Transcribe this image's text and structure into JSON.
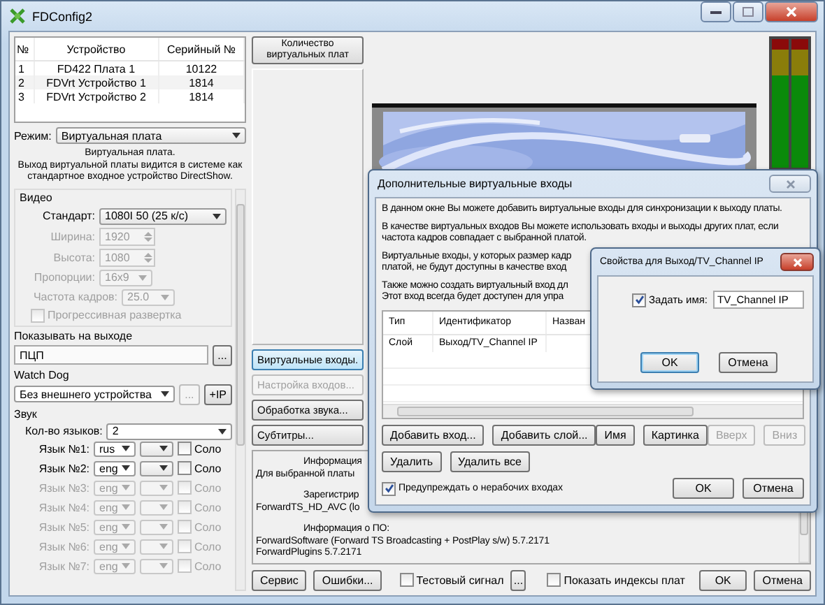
{
  "window": {
    "title": "FDConfig2"
  },
  "boards": {
    "columns": [
      "№",
      "Устройство",
      "Серийный №"
    ],
    "rows": [
      [
        "1",
        "FD422 Плата 1",
        "10122"
      ],
      [
        "2",
        "FDVrt Устройство 1",
        "1814"
      ],
      [
        "3",
        "FDVrt Устройство 2",
        "1814"
      ]
    ]
  },
  "mode": {
    "label": "Режим:",
    "value": "Виртуальная плата"
  },
  "mode_description": "Виртуальная плата.\nВыход виртуальной платы видится в системе как\nстандартное входное устройство DirectShow.",
  "video": {
    "title": "Видео",
    "fields": [
      {
        "kind": "select",
        "label": "Стандарт:",
        "value": "1080I 50 (25 к/с)",
        "disabled": false
      },
      {
        "kind": "spin",
        "label": "Ширина:",
        "value": "1920",
        "disabled": true
      },
      {
        "kind": "spin",
        "label": "Высота:",
        "value": "1080",
        "disabled": true
      },
      {
        "kind": "select",
        "label": "Пропорции:",
        "value": "16x9",
        "disabled": true
      },
      {
        "kind": "select",
        "label": "Частота кадров:",
        "value": "25.0",
        "disabled": true
      }
    ],
    "progressive": {
      "label": "Прогрессивная развертка",
      "checked": false,
      "disabled": true
    }
  },
  "output": {
    "title": "Показывать на выходе",
    "value": "ПЦП",
    "button": "..."
  },
  "watchdog": {
    "title": "Watch Dog",
    "value": "Без внешнего устройства",
    "buttons": [
      {
        "label": "...",
        "disabled": true
      },
      {
        "label": "+IP",
        "disabled": false
      }
    ]
  },
  "sound": {
    "title": "Звук",
    "count_label": "Кол-во языков:",
    "count": "2",
    "languages": [
      {
        "label": "Язык №1:",
        "lang": "rus",
        "solo_label": "Соло",
        "solo": false,
        "disabled": false
      },
      {
        "label": "Язык №2:",
        "lang": "eng",
        "solo_label": "Соло",
        "solo": false,
        "disabled": false
      },
      {
        "label": "Язык №3:",
        "lang": "eng",
        "solo_label": "Соло",
        "solo": false,
        "disabled": true
      },
      {
        "label": "Язык №4:",
        "lang": "eng",
        "solo_label": "Соло",
        "solo": false,
        "disabled": true
      },
      {
        "label": "Язык №5:",
        "lang": "eng",
        "solo_label": "Соло",
        "solo": false,
        "disabled": true
      },
      {
        "label": "Язык №6:",
        "lang": "eng",
        "solo_label": "Соло",
        "solo": false,
        "disabled": true
      },
      {
        "label": "Язык №7:",
        "lang": "eng",
        "solo_label": "Соло",
        "solo": false,
        "disabled": true
      }
    ]
  },
  "boards_count_button": "Количество\nвиртуальных плат",
  "side_buttons": [
    {
      "label": "Виртуальные входы.",
      "selected": true,
      "disabled": false
    },
    {
      "label": "Настройка входов...",
      "selected": false,
      "disabled": true
    },
    {
      "label": "Обработка звука...",
      "selected": false,
      "disabled": false
    },
    {
      "label": "Субтитры...",
      "selected": false,
      "disabled": false
    }
  ],
  "meters": [
    {
      "level": 1
    },
    {
      "level": 1
    }
  ],
  "info": [
    {
      "heading": "Информация",
      "lines": [
        "Для выбранной платы"
      ]
    },
    {
      "heading": "Зарегистрир",
      "lines": [
        "ForwardTS_HD_AVC (lo"
      ]
    },
    {
      "heading": "Информация о ПО:",
      "lines": [
        "ForwardSoftware (Forward TS Broadcasting + PostPlay s/w) 5.7.2171",
        "ForwardPlugins 5.7.2171"
      ]
    }
  ],
  "footer": {
    "left_buttons": [
      "Сервис",
      "Ошибки..."
    ],
    "test_signal": {
      "label": "Тестовый сигнал",
      "checked": false
    },
    "test_button": "...",
    "show_indices": {
      "label": "Показать индексы плат",
      "checked": false
    },
    "buttons": [
      "OK",
      "Отмена"
    ]
  },
  "virtual_inputs_dialog": {
    "title": "Дополнительные виртуальные входы",
    "paragraphs": [
      "В данном окне Вы можете добавить виртуальные входы для синхронизации к выходу платы.",
      "В качестве виртуальных входов Вы можете использовать входы и выходы других плат, если частота кадров совпадает с выбранной платой.",
      "Виртуальные входы, у которых размер кадр\nплатой, не будут доступны в качестве вход",
      "Также можно создать виртуальный вход дл\nЭтот вход всегда будет доступен для упра"
    ],
    "table": {
      "columns": [
        "Тип",
        "Идентификатор",
        "Назван"
      ],
      "rows": [
        [
          "Слой",
          "Выход/TV_Channel IP"
        ]
      ]
    },
    "button_rows": [
      [
        [
          {
            "label": "Добавить вход...",
            "disabled": false
          },
          {
            "label": "Добавить слой...",
            "disabled": false
          }
        ],
        [
          {
            "label": "Имя",
            "disabled": false
          },
          {
            "label": "Картинка",
            "disabled": false
          }
        ],
        [
          {
            "label": "Вверх",
            "disabled": true
          },
          {
            "label": "Вниз",
            "disabled": true
          }
        ]
      ],
      [
        [
          {
            "label": "Удалить",
            "disabled": false
          },
          {
            "label": "Удалить все",
            "disabled": false
          }
        ]
      ]
    ],
    "warn": {
      "label": "Предупреждать о нерабочих входах",
      "checked": true
    },
    "buttons": [
      "OK",
      "Отмена"
    ]
  },
  "properties_dialog": {
    "title": "Свойства для Выход/TV_Channel IP",
    "name_checkbox": {
      "label": "Задать имя:",
      "checked": true
    },
    "name_value": "TV_Channel IP",
    "buttons": [
      {
        "label": "OK",
        "default": true
      },
      {
        "label": "Отмена",
        "default": false
      }
    ]
  }
}
